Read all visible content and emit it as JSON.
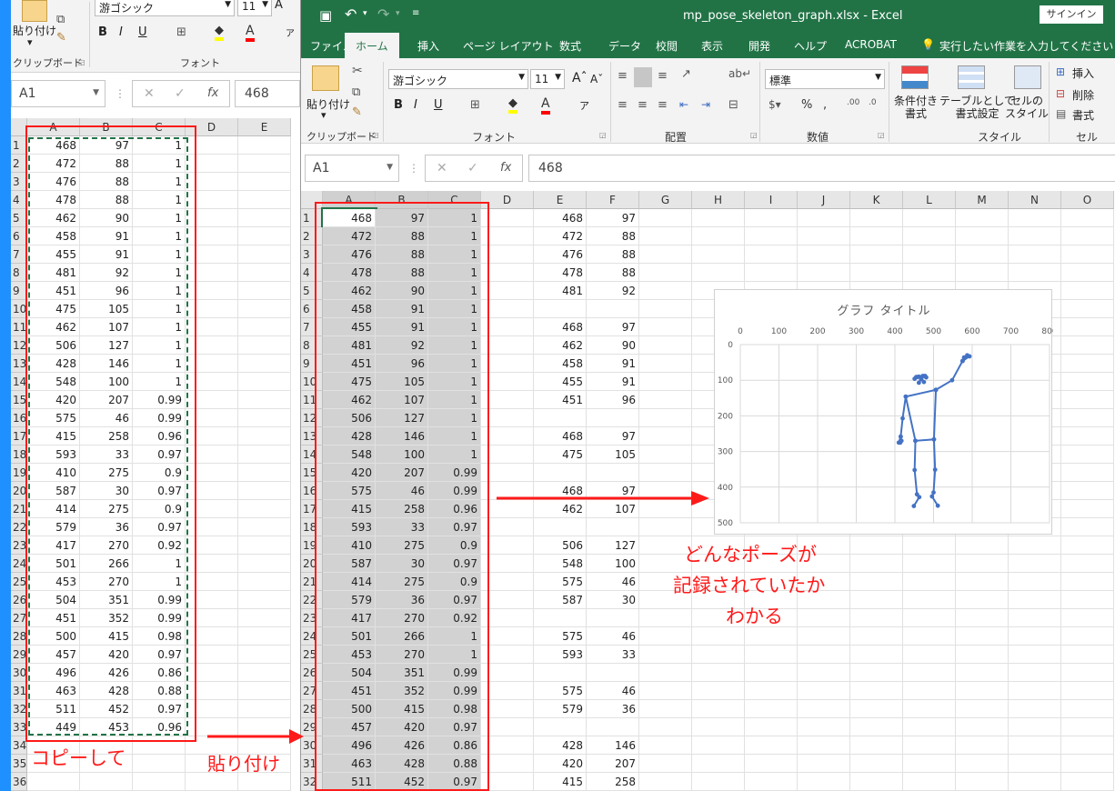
{
  "left_window": {
    "clipboard_label": "クリップボード",
    "paste_label": "貼り付け",
    "font_group_label": "フォント",
    "font_name": "游ゴシック",
    "font_size": "11",
    "name_box": "A1",
    "formula_value": "468",
    "columns": [
      "A",
      "B",
      "C",
      "D",
      "E"
    ],
    "rows": [
      [
        "468",
        "97",
        "1"
      ],
      [
        "472",
        "88",
        "1"
      ],
      [
        "476",
        "88",
        "1"
      ],
      [
        "478",
        "88",
        "1"
      ],
      [
        "462",
        "90",
        "1"
      ],
      [
        "458",
        "91",
        "1"
      ],
      [
        "455",
        "91",
        "1"
      ],
      [
        "481",
        "92",
        "1"
      ],
      [
        "451",
        "96",
        "1"
      ],
      [
        "475",
        "105",
        "1"
      ],
      [
        "462",
        "107",
        "1"
      ],
      [
        "506",
        "127",
        "1"
      ],
      [
        "428",
        "146",
        "1"
      ],
      [
        "548",
        "100",
        "1"
      ],
      [
        "420",
        "207",
        "0.99"
      ],
      [
        "575",
        "46",
        "0.99"
      ],
      [
        "415",
        "258",
        "0.96"
      ],
      [
        "593",
        "33",
        "0.97"
      ],
      [
        "410",
        "275",
        "0.9"
      ],
      [
        "587",
        "30",
        "0.97"
      ],
      [
        "414",
        "275",
        "0.9"
      ],
      [
        "579",
        "36",
        "0.97"
      ],
      [
        "417",
        "270",
        "0.92"
      ],
      [
        "501",
        "266",
        "1"
      ],
      [
        "453",
        "270",
        "1"
      ],
      [
        "504",
        "351",
        "0.99"
      ],
      [
        "451",
        "352",
        "0.99"
      ],
      [
        "500",
        "415",
        "0.98"
      ],
      [
        "457",
        "420",
        "0.97"
      ],
      [
        "496",
        "426",
        "0.86"
      ],
      [
        "463",
        "428",
        "0.88"
      ],
      [
        "511",
        "452",
        "0.97"
      ],
      [
        "449",
        "453",
        "0.96"
      ],
      [
        "",
        "",
        " "
      ],
      [
        "",
        "",
        ""
      ],
      [
        "",
        "",
        ""
      ]
    ],
    "row_numbers": [
      "1",
      "2",
      "3",
      "4",
      "5",
      "6",
      "7",
      "8",
      "9",
      "10",
      "11",
      "12",
      "13",
      "14",
      "15",
      "16",
      "17",
      "18",
      "19",
      "20",
      "21",
      "22",
      "23",
      "24",
      "25",
      "26",
      "27",
      "28",
      "29",
      "30",
      "31",
      "32",
      "33",
      "34",
      "35",
      "36"
    ]
  },
  "right_window": {
    "file_title": "mp_pose_skeleton_graph.xlsx  -  Excel",
    "signin": "サインイン",
    "tabs": [
      "ファイル",
      "ホーム",
      "挿入",
      "ページ レイアウト",
      "数式",
      "データ",
      "校閲",
      "表示",
      "開発",
      "ヘルプ",
      "ACROBAT"
    ],
    "tell_me": "実行したい作業を入力してください",
    "ribbon": {
      "paste": "貼り付け",
      "clipboard": "クリップボード",
      "font_name": "游ゴシック",
      "font_size": "11",
      "font_group": "フォント",
      "alignment_group": "配置",
      "number_format": "標準",
      "number_group": "数値",
      "cond_format": "条件付き\n書式",
      "table_format": "テーブルとして\n書式設定",
      "cell_style": "セルの\nスタイル",
      "style_group": "スタイル",
      "insert": "挿入",
      "delete": "削除",
      "format": "書式",
      "cells_group": "セル"
    },
    "name_box": "A1",
    "formula_value": "468",
    "columns": [
      "A",
      "B",
      "C",
      "D",
      "E",
      "F",
      "G",
      "H",
      "I",
      "J",
      "K",
      "L",
      "M",
      "N",
      "O"
    ],
    "row_numbers": [
      "1",
      "2",
      "3",
      "4",
      "5",
      "6",
      "7",
      "8",
      "9",
      "10",
      "11",
      "12",
      "13",
      "14",
      "15",
      "16",
      "17",
      "18",
      "19",
      "20",
      "21",
      "22",
      "23",
      "24",
      "25",
      "26",
      "27",
      "28",
      "29",
      "30",
      "31",
      "32"
    ],
    "abc_rows": [
      [
        "468",
        "97",
        "1"
      ],
      [
        "472",
        "88",
        "1"
      ],
      [
        "476",
        "88",
        "1"
      ],
      [
        "478",
        "88",
        "1"
      ],
      [
        "462",
        "90",
        "1"
      ],
      [
        "458",
        "91",
        "1"
      ],
      [
        "455",
        "91",
        "1"
      ],
      [
        "481",
        "92",
        "1"
      ],
      [
        "451",
        "96",
        "1"
      ],
      [
        "475",
        "105",
        "1"
      ],
      [
        "462",
        "107",
        "1"
      ],
      [
        "506",
        "127",
        "1"
      ],
      [
        "428",
        "146",
        "1"
      ],
      [
        "548",
        "100",
        "1"
      ],
      [
        "420",
        "207",
        "0.99"
      ],
      [
        "575",
        "46",
        "0.99"
      ],
      [
        "415",
        "258",
        "0.96"
      ],
      [
        "593",
        "33",
        "0.97"
      ],
      [
        "410",
        "275",
        "0.9"
      ],
      [
        "587",
        "30",
        "0.97"
      ],
      [
        "414",
        "275",
        "0.9"
      ],
      [
        "579",
        "36",
        "0.97"
      ],
      [
        "417",
        "270",
        "0.92"
      ],
      [
        "501",
        "266",
        "1"
      ],
      [
        "453",
        "270",
        "1"
      ],
      [
        "504",
        "351",
        "0.99"
      ],
      [
        "451",
        "352",
        "0.99"
      ],
      [
        "500",
        "415",
        "0.98"
      ],
      [
        "457",
        "420",
        "0.97"
      ],
      [
        "496",
        "426",
        "0.86"
      ],
      [
        "463",
        "428",
        "0.88"
      ],
      [
        "511",
        "452",
        "0.97"
      ]
    ],
    "ef_rows": [
      [
        "468",
        "97"
      ],
      [
        "472",
        "88"
      ],
      [
        "476",
        "88"
      ],
      [
        "478",
        "88"
      ],
      [
        "481",
        "92"
      ],
      [
        "",
        ""
      ],
      [
        "468",
        "97"
      ],
      [
        "462",
        "90"
      ],
      [
        "458",
        "91"
      ],
      [
        "455",
        "91"
      ],
      [
        "451",
        "96"
      ],
      [
        "",
        ""
      ],
      [
        "468",
        "97"
      ],
      [
        "475",
        "105"
      ],
      [
        "",
        ""
      ],
      [
        "468",
        "97"
      ],
      [
        "462",
        "107"
      ],
      [
        "",
        ""
      ],
      [
        "506",
        "127"
      ],
      [
        "548",
        "100"
      ],
      [
        "575",
        "46"
      ],
      [
        "587",
        "30"
      ],
      [
        "",
        ""
      ],
      [
        "575",
        "46"
      ],
      [
        "593",
        "33"
      ],
      [
        "",
        ""
      ],
      [
        "575",
        "46"
      ],
      [
        "579",
        "36"
      ],
      [
        "",
        ""
      ],
      [
        "428",
        "146"
      ],
      [
        "420",
        "207"
      ],
      [
        "415",
        "258"
      ]
    ]
  },
  "chart_data": {
    "type": "scatter",
    "title": "グラフ タイトル",
    "x_ticks": [
      "0",
      "100",
      "200",
      "300",
      "400",
      "500",
      "600",
      "700",
      "800"
    ],
    "y_ticks": [
      "0",
      "100",
      "200",
      "300",
      "400",
      "500"
    ],
    "xlim": [
      0,
      800
    ],
    "ylim": [
      0,
      500
    ],
    "y_reversed": true,
    "x_axis_position": "top",
    "series_color": "#4472c4",
    "segments": [
      [
        [
          468,
          97
        ],
        [
          472,
          88
        ],
        [
          476,
          88
        ],
        [
          478,
          88
        ],
        [
          481,
          92
        ]
      ],
      [
        [
          468,
          97
        ],
        [
          462,
          90
        ],
        [
          458,
          91
        ],
        [
          455,
          91
        ],
        [
          451,
          96
        ]
      ],
      [
        [
          468,
          97
        ],
        [
          475,
          105
        ]
      ],
      [
        [
          468,
          97
        ],
        [
          462,
          107
        ]
      ],
      [
        [
          506,
          127
        ],
        [
          548,
          100
        ],
        [
          575,
          46
        ],
        [
          587,
          30
        ],
        [
          575,
          46
        ],
        [
          593,
          33
        ],
        [
          575,
          46
        ],
        [
          579,
          36
        ]
      ],
      [
        [
          428,
          146
        ],
        [
          420,
          207
        ],
        [
          415,
          258
        ],
        [
          410,
          275
        ],
        [
          414,
          275
        ],
        [
          415,
          258
        ],
        [
          417,
          270
        ]
      ],
      [
        [
          506,
          127
        ],
        [
          501,
          266
        ],
        [
          453,
          270
        ],
        [
          428,
          146
        ],
        [
          506,
          127
        ]
      ],
      [
        [
          501,
          266
        ],
        [
          504,
          351
        ],
        [
          500,
          415
        ],
        [
          496,
          426
        ],
        [
          511,
          452
        ]
      ],
      [
        [
          453,
          270
        ],
        [
          451,
          352
        ],
        [
          457,
          420
        ],
        [
          463,
          428
        ],
        [
          449,
          453
        ]
      ]
    ]
  },
  "annotations": {
    "copy": "コピーして",
    "paste": "貼り付け",
    "pose_note_lines": [
      "どんなポーズが",
      "記録されていたか",
      "わかる"
    ]
  },
  "colors": {
    "excel_green": "#217346",
    "annotation_red": "#ff1a1a",
    "selection_gray": "#d2d2d2",
    "copy_marquee": "#217346"
  }
}
